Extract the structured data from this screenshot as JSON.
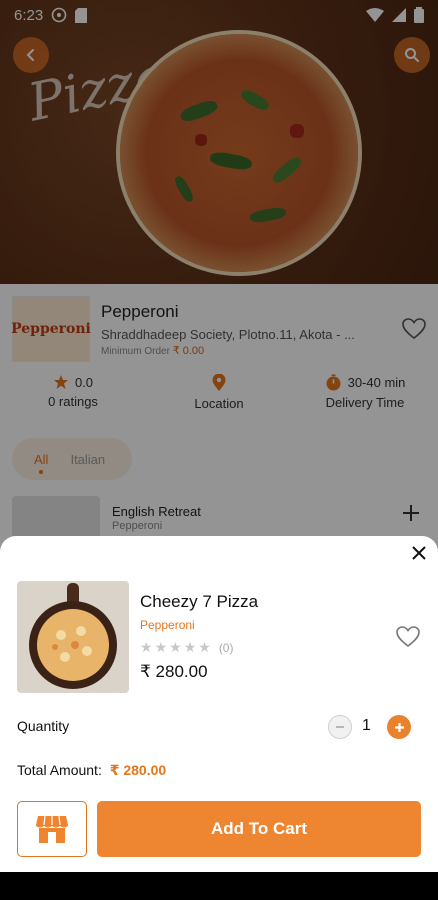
{
  "status_bar": {
    "time": "6:23"
  },
  "hero": {
    "banner_text": "Pizza"
  },
  "restaurant": {
    "logo_text": "Pepperoni",
    "name": "Pepperoni",
    "address": "Shraddhadeep Society, Plotno.11, Akota - ...",
    "min_order_label": "Minimum Order",
    "min_order_value": "₹ 0.00"
  },
  "stats": {
    "rating_value": "0.0",
    "rating_label": "0 ratings",
    "location_label": "Location",
    "delivery_value": "30-40 min",
    "delivery_label": "Delivery Time"
  },
  "categories": {
    "active": "All",
    "inactive": "Italian"
  },
  "menu_item": {
    "title": "English Retreat",
    "subtitle": "Pepperoni"
  },
  "sheet": {
    "product_title": "Cheezy 7 Pizza",
    "product_restaurant": "Pepperoni",
    "rating_count": "(0)",
    "price": "₹ 280.00",
    "quantity_label": "Quantity",
    "quantity_value": "1",
    "total_label": "Total Amount:",
    "total_value": "₹ 280.00",
    "add_to_cart_label": "Add To Cart"
  },
  "colors": {
    "accent": "#EE8530",
    "accent_text": "#E3761D"
  },
  "icons": [
    "back-icon",
    "search-icon",
    "heart-icon",
    "star-icon",
    "location-pin-icon",
    "timer-icon",
    "plus-icon",
    "close-icon",
    "minus-icon",
    "store-icon"
  ]
}
